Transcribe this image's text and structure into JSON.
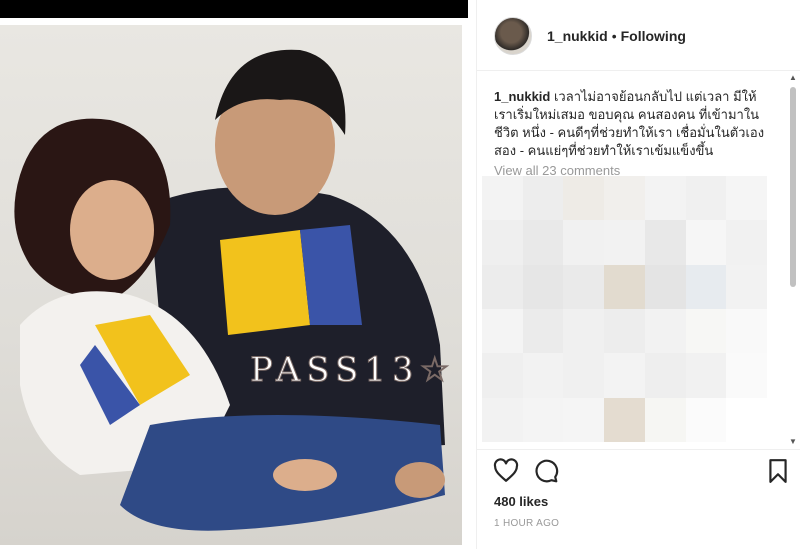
{
  "post": {
    "username": "1_nukkid",
    "follow_status": "Following",
    "separator": "•",
    "caption_user": "1_nukkid",
    "caption_text": "เวลาไม่อาจย้อนกลับไป แต่เวลา มีให้เราเริ่มใหม่เสมอ ขอบคุณ คนสองคน ที่เข้ามาในชีวิต หนึ่ง - คนดีๆที่ช่วยทำให้เรา เชื่อมั่นในตัวเอง สอง - คนแย่ๆที่ช่วยทำให้เราเข้มแข็งขึ้น",
    "view_all_comments": "View all 23 comments",
    "likes": "480 likes",
    "timestamp": "1 HOUR AGO"
  },
  "photo": {
    "watermark": "PASS13☆"
  },
  "icons": {
    "like": "heart-icon",
    "comment": "comment-bubble-icon",
    "save": "bookmark-icon",
    "scroll_up": "▲",
    "scroll_down": "▼"
  },
  "colors": {
    "text": "#262626",
    "muted": "#999999",
    "divider": "#efefef"
  }
}
